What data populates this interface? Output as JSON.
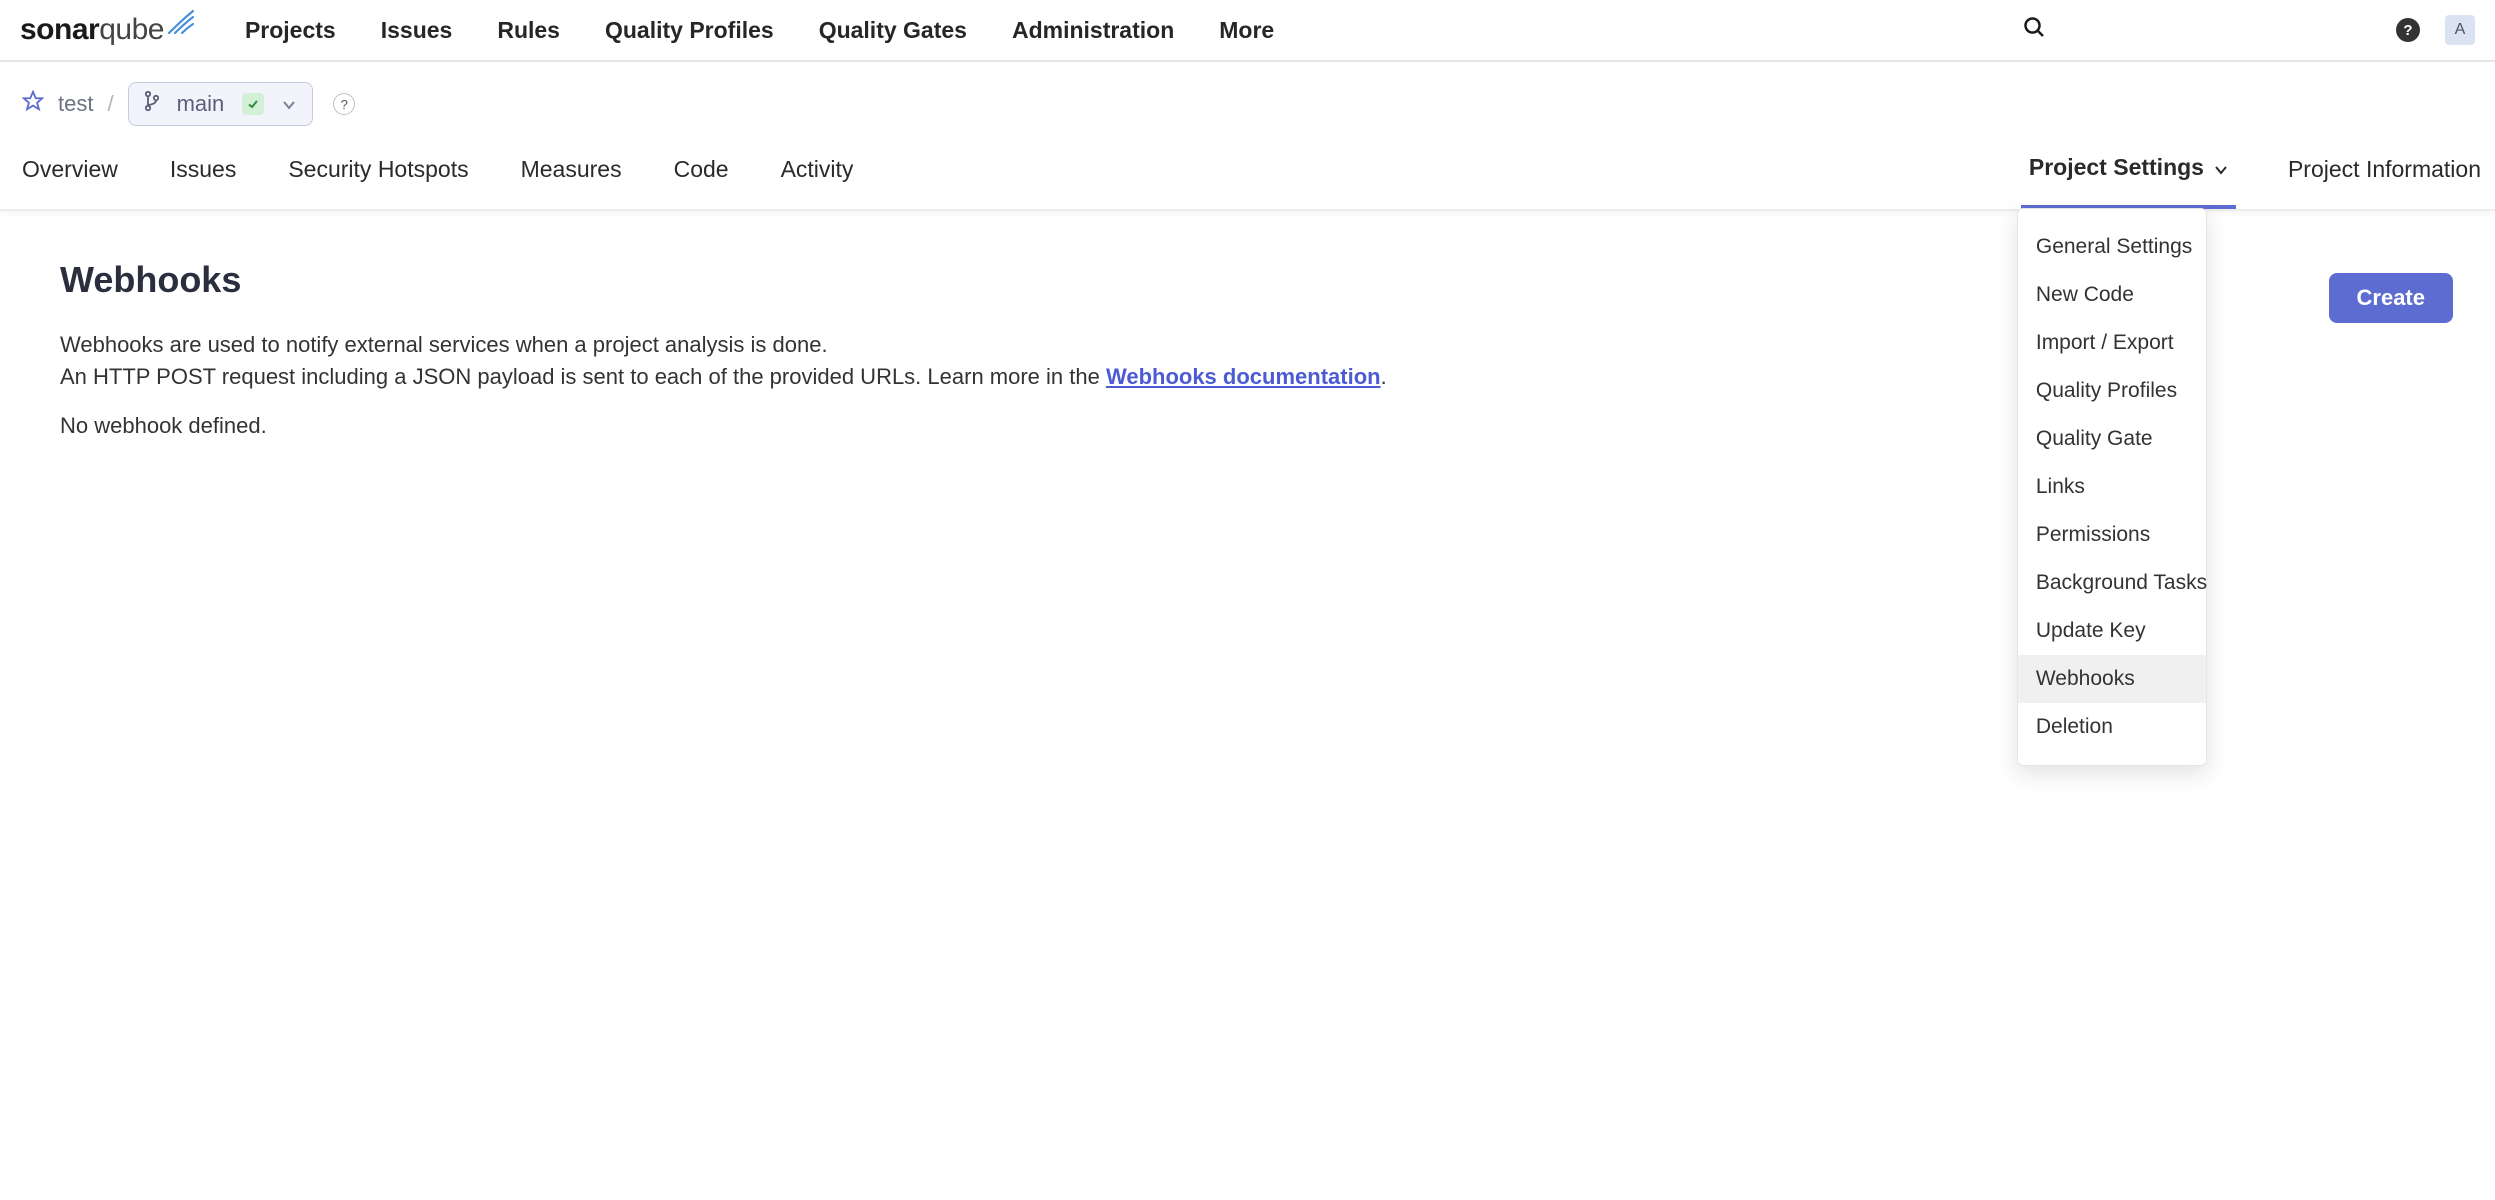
{
  "topnav": {
    "links": [
      "Projects",
      "Issues",
      "Rules",
      "Quality Profiles",
      "Quality Gates",
      "Administration",
      "More"
    ],
    "avatar_initial": "A",
    "help": "?"
  },
  "breadcrumb": {
    "project": "test",
    "branch": "main",
    "help": "?"
  },
  "project_tabs": [
    "Overview",
    "Issues",
    "Security Hotspots",
    "Measures",
    "Code",
    "Activity"
  ],
  "project_settings_label": "Project Settings",
  "project_information_label": "Project Information",
  "settings_menu": [
    "General Settings",
    "New Code",
    "Import / Export",
    "Quality Profiles",
    "Quality Gate",
    "Links",
    "Permissions",
    "Background Tasks",
    "Update Key",
    "Webhooks",
    "Deletion"
  ],
  "settings_active_index": 9,
  "page": {
    "title": "Webhooks",
    "desc_line1": "Webhooks are used to notify external services when a project analysis is done.",
    "desc_line2_pre": "An HTTP POST request including a JSON payload is sent to each of the provided URLs. Learn more in the ",
    "desc_link": "Webhooks documentation",
    "desc_line2_post": ".",
    "empty": "No webhook defined.",
    "create_btn": "Create"
  }
}
